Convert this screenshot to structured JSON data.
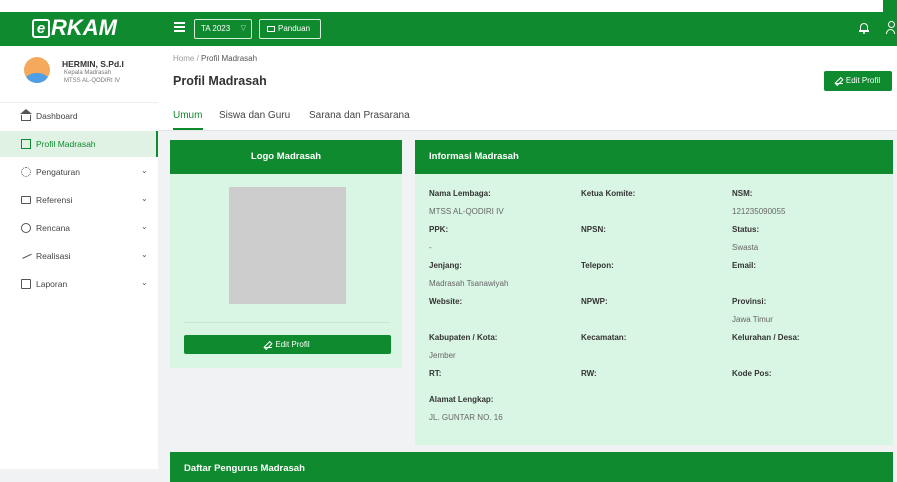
{
  "header": {
    "logo_letter": "e",
    "logo_text": "RKAM",
    "ta_select": "TA 2023",
    "panduan_label": "Panduan"
  },
  "sidebar": {
    "profile": {
      "name": "HERMIN, S.Pd.I",
      "role": "Kepala Madrasah",
      "school": "MTSS AL-QODIRI IV"
    },
    "items": [
      {
        "label": "Dashboard",
        "icon": "home-icon"
      },
      {
        "label": "Profil Madrasah",
        "icon": "grid-icon"
      },
      {
        "label": "Pengaturan",
        "icon": "gear-icon"
      },
      {
        "label": "Referensi",
        "icon": "folder-icon"
      },
      {
        "label": "Rencana",
        "icon": "clock-icon"
      },
      {
        "label": "Realisasi",
        "icon": "trend-icon"
      },
      {
        "label": "Laporan",
        "icon": "report-icon"
      }
    ]
  },
  "breadcrumb": {
    "home": "Home",
    "sep": "/",
    "current": "Profil Madrasah"
  },
  "page_title": "Profil Madrasah",
  "edit_profil_label": "Edit Profil",
  "tabs": [
    "Umum",
    "Siswa dan Guru",
    "Sarana dan Prasarana"
  ],
  "logo_card": {
    "title": "Logo Madrasah",
    "button": "Edit Profil"
  },
  "info_card": {
    "title": "Informasi Madrasah",
    "fields": [
      {
        "label": "Nama Lembaga",
        "value": "MTSS AL-QODIRI IV"
      },
      {
        "label": "Ketua Komite",
        "value": ""
      },
      {
        "label": "NSM",
        "value": "121235090055"
      },
      {
        "label": "PPK",
        "value": "-"
      },
      {
        "label": "NPSN",
        "value": ""
      },
      {
        "label": "Status",
        "value": "Swasta"
      },
      {
        "label": "Jenjang",
        "value": "Madrasah Tsanawiyah"
      },
      {
        "label": "Telepon",
        "value": ""
      },
      {
        "label": "Email",
        "value": ""
      },
      {
        "label": "Website",
        "value": ""
      },
      {
        "label": "NPWP",
        "value": ""
      },
      {
        "label": "Provinsi",
        "value": "Jawa Timur"
      },
      {
        "label": "Kabupaten / Kota",
        "value": "Jember"
      },
      {
        "label": "Kecamatan",
        "value": ""
      },
      {
        "label": "Kelurahan / Desa",
        "value": ""
      },
      {
        "label": "RT",
        "value": ""
      },
      {
        "label": "RW",
        "value": ""
      },
      {
        "label": "Kode Pos",
        "value": ""
      },
      {
        "label": "Alamat Lengkap",
        "value": "JL. GUNTAR NO. 16"
      }
    ]
  },
  "bottom_card": {
    "title": "Daftar Pengurus Madrasah"
  },
  "colors": {
    "primary": "#108a2e",
    "light": "#d9f5e3",
    "background": "#f1f2f4"
  }
}
